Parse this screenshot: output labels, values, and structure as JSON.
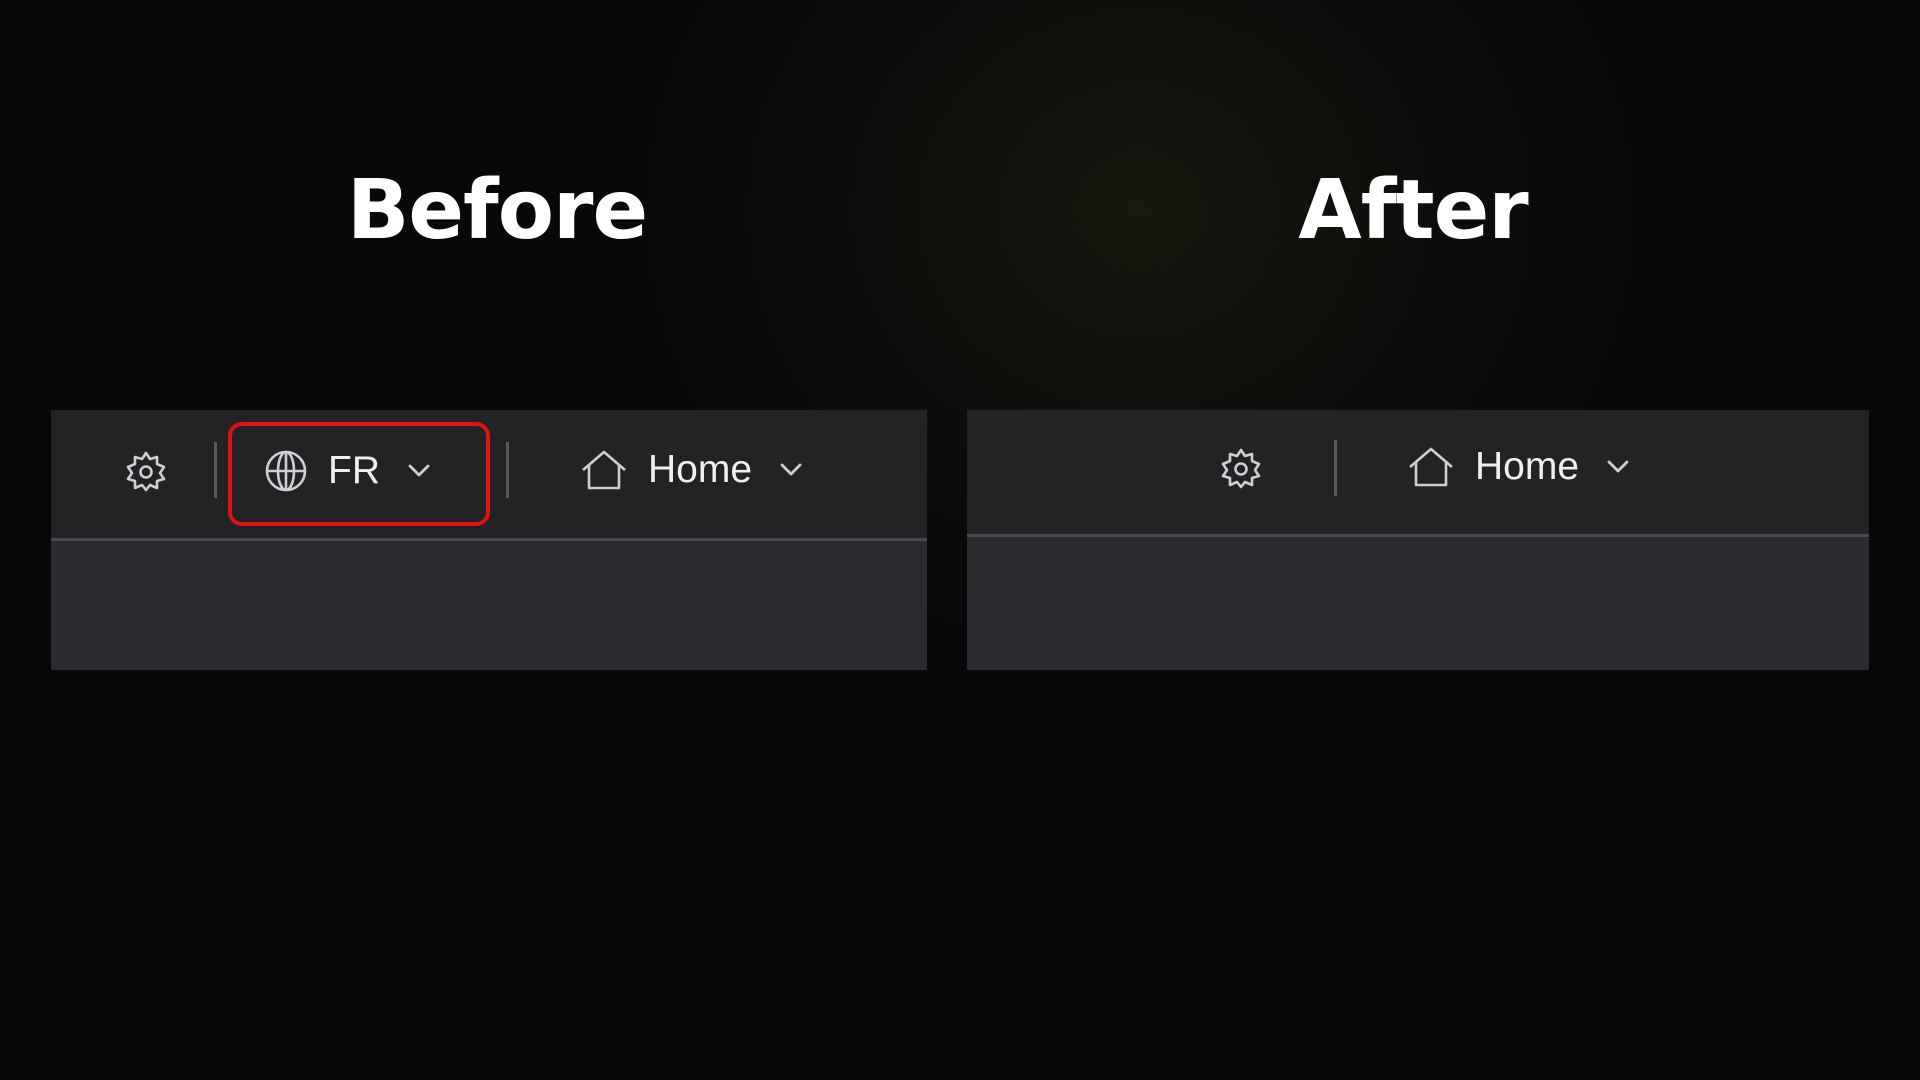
{
  "headings": {
    "before": "Before",
    "after": "After"
  },
  "colors": {
    "background": "#08070a",
    "toolbar": "#232225",
    "panel": "#2b2a2e",
    "highlight": "#e0140f",
    "text": "#f0f0f2"
  },
  "before_toolbar": {
    "settings_icon": "gear-icon",
    "language_icon": "globe-icon",
    "language_label": "FR",
    "home_icon": "home-icon",
    "home_label": "Home"
  },
  "after_toolbar": {
    "settings_icon": "gear-icon",
    "home_icon": "home-icon",
    "home_label": "Home"
  }
}
